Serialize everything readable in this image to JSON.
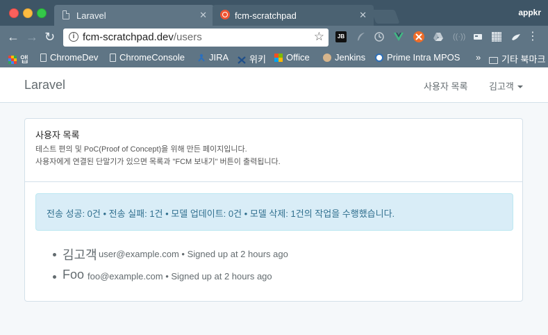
{
  "window": {
    "profile_name": "appkr"
  },
  "tabs": [
    {
      "title": "Laravel",
      "close": "✕"
    },
    {
      "title": "fcm-scratchpad",
      "close": "✕"
    }
  ],
  "toolbar": {
    "back": "←",
    "forward": "→",
    "reload": "↻",
    "url_host": "fcm-scratchpad.dev",
    "url_path": "/users",
    "menu": "⋮",
    "info": "i",
    "star": "☆"
  },
  "extensions": [
    "JB",
    "feather-icon",
    "clock-icon",
    "vue-icon",
    "gear-icon",
    "drive-icon",
    "wave-icon",
    "card-icon",
    "grid-icon",
    "bird-icon"
  ],
  "bookmarks": {
    "items": [
      {
        "label": "앱",
        "icon": "apps-grid-icon"
      },
      {
        "label": "ChromeDev",
        "icon": "document-icon"
      },
      {
        "label": "ChromeConsole",
        "icon": "document-icon"
      },
      {
        "label": "JIRA",
        "icon": "jira-icon"
      },
      {
        "label": "위키",
        "icon": "wiki-icon"
      },
      {
        "label": "Office",
        "icon": "office-icon"
      },
      {
        "label": "Jenkins",
        "icon": "jenkins-icon"
      },
      {
        "label": "Prime Intra MPOS",
        "icon": "prime-icon"
      }
    ],
    "overflow": "»",
    "other_folder": "기타 북마크"
  },
  "navbar": {
    "brand": "Laravel",
    "users_link": "사용자 목록",
    "user_menu": "김고객"
  },
  "panel": {
    "title": "사용자 목록",
    "description_1": "테스트 편의 및 PoC(Proof of Concept)을 위해 만든 페이지입니다.",
    "description_2": "사용자에게 연결된 단말기가 있으면 목록과 \"FCM 보내기\" 버튼이 출력됩니다."
  },
  "alert": {
    "message": "전송 성공: 0건 • 전송 실패: 1건 • 모델 업데이트: 0건 • 모델 삭제: 1건의 작업을 수행했습니다."
  },
  "users": [
    {
      "name": "김고객",
      "meta": "user@example.com • Signed up at 2 hours ago"
    },
    {
      "name": "Foo",
      "meta": "foo@example.com • Signed up at 2 hours ago"
    }
  ],
  "colors": {
    "titlebar": "#3e5566",
    "toolbar": "#5f7585",
    "page_bg": "#f5f8fa",
    "alert_bg": "#d9edf7",
    "alert_text": "#31708f",
    "text": "#636b6f"
  }
}
